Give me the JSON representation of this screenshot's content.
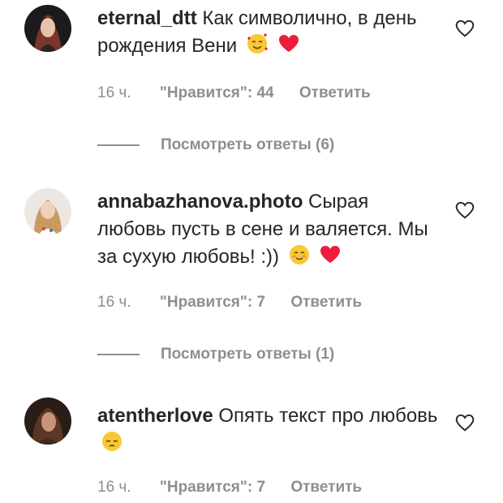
{
  "comments": [
    {
      "username": "eternal_dtt",
      "text": "Как символично, в день рождения Вени",
      "emojis": [
        "smiling-face-with-hearts",
        "red-heart"
      ],
      "time": "16 ч.",
      "likes": "\"Нравится\": 44",
      "reply": "Ответить",
      "view_replies": "Посмотреть ответы (6)"
    },
    {
      "username": "annabazhanova.photo",
      "text": "Сырая любовь пусть в сене и валяется. Мы за сухую любовь! :))",
      "emojis": [
        "smiling-face-with-smiling-eyes",
        "red-heart"
      ],
      "time": "16 ч.",
      "likes": "\"Нравится\": 7",
      "reply": "Ответить",
      "view_replies": "Посмотреть ответы (1)"
    },
    {
      "username": "atentherlove",
      "text": "Опять текст про любовь",
      "emojis": [
        "pensive-face"
      ],
      "time": "16 ч.",
      "likes": "\"Нравится\": 7",
      "reply": "Ответить"
    }
  ],
  "colors": {
    "text": "#262626",
    "secondary": "#8e8e8e",
    "heart": "#ed1c3b",
    "emoji_yellow": "#f9c932"
  },
  "icons": {
    "like": "heart-outline-icon"
  }
}
